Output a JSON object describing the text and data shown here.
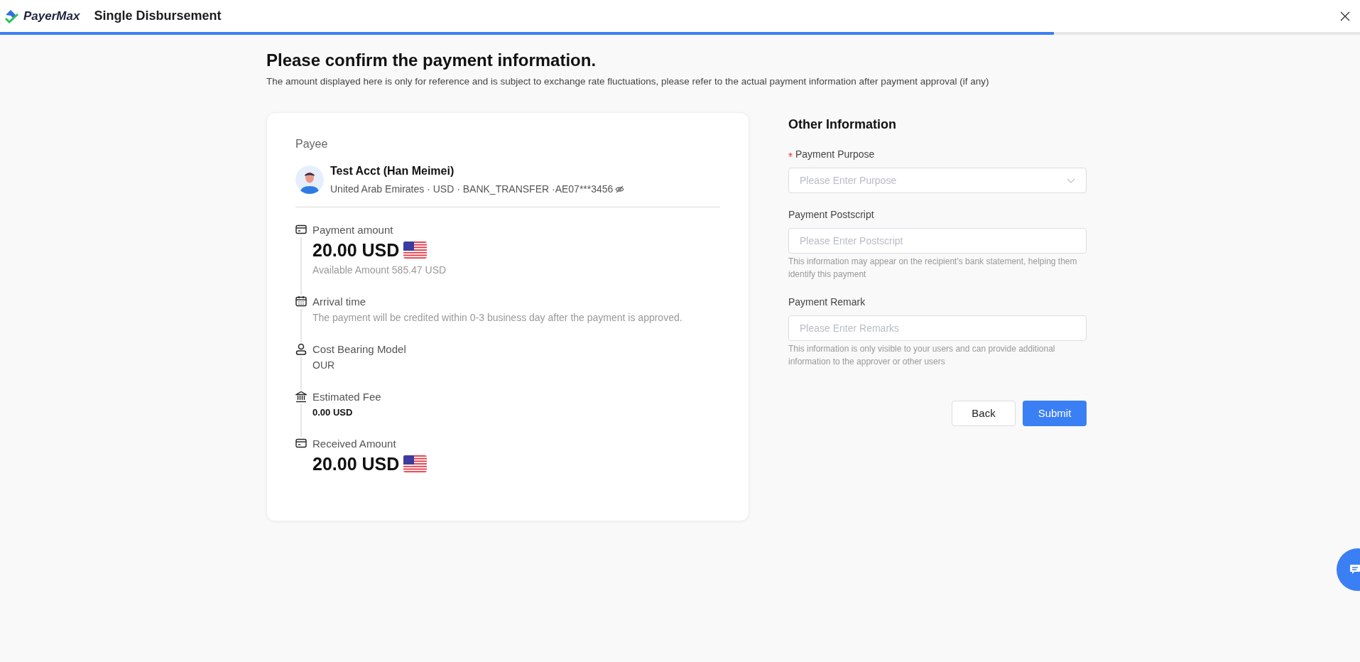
{
  "header": {
    "brand": "PayerMax",
    "title": "Single Disbursement",
    "progress": {
      "level": 0.775
    }
  },
  "page": {
    "title": "Please confirm the payment information.",
    "subtitle": "The amount displayed here is only for reference and is subject to exchange rate fluctuations, please refer to the actual payment information after payment approval (if any)"
  },
  "payee": {
    "label": "Payee",
    "name": "Test Acct (Han Meimei)",
    "details": "United Arab Emirates · USD · BANK_TRANSFER ·AE07***3456"
  },
  "timeline": [
    {
      "kind": "amount",
      "label": "Payment amount",
      "value": "20.00 USD",
      "note": "Available Amount 585.47 USD"
    },
    {
      "kind": "note",
      "label": "Arrival time",
      "value": "The payment will be credited within 0-3 business day after the payment is approved."
    },
    {
      "kind": "plain",
      "label": "Cost Bearing Model",
      "value": "OUR"
    },
    {
      "kind": "fee",
      "label": "Estimated Fee",
      "value": "0.00 USD"
    },
    {
      "kind": "amount",
      "label": "Received Amount",
      "value": "20.00 USD"
    }
  ],
  "other": {
    "title": "Other Information",
    "fields": [
      {
        "kind": "select",
        "label": "Payment Purpose",
        "required": true,
        "placeholder": "Please Enter Purpose"
      },
      {
        "kind": "text",
        "label": "Payment Postscript",
        "required": false,
        "placeholder": "Please Enter Postscript",
        "help": "This information may appear on the recipient's bank statement, helping them identify this payment"
      },
      {
        "kind": "text",
        "label": "Payment Remark",
        "required": false,
        "placeholder": "Please Enter Remarks",
        "help": "This information is only visible to your users and can provide additional information to the approver or other users"
      }
    ],
    "buttons": [
      {
        "kind": "secondary",
        "label": "Back"
      },
      {
        "kind": "primary",
        "label": "Submit"
      }
    ]
  }
}
